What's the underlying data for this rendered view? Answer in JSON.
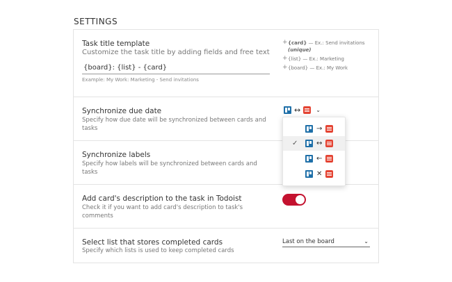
{
  "section_heading": "SETTINGS",
  "task_title": {
    "title": "Task title template",
    "description": "Customize the task title by adding fields and free text",
    "value": "{board}: {list} - {card}",
    "example": "Example: My Work: Marketing - Send invitations",
    "hints": [
      {
        "field": "{card}",
        "text": " — Ex.: Send invitations ",
        "note": "(unique)"
      },
      {
        "field": "{list}",
        "text": " — Ex.: Marketing",
        "note": ""
      },
      {
        "field": "{board}",
        "text": " — Ex.: My Work",
        "note": ""
      }
    ]
  },
  "due_date": {
    "title": "Synchronize due date",
    "description": "Specify how due date will be synchronized between cards and tasks",
    "selected_direction": "↔"
  },
  "labels": {
    "title": "Synchronize labels",
    "description": "Specify how labels will be synchronized between cards and tasks"
  },
  "description_opt": {
    "title": "Add card's description to the task in Todoist",
    "description": "Check it if you want to add card's description to task's comments",
    "enabled": true
  },
  "completed_list": {
    "title": "Select list that stores completed cards",
    "description": "Specify which lists is used to keep completed cards",
    "selected": "Last on the board"
  },
  "sync_menu": {
    "options": [
      {
        "arrow": "→",
        "checked": false
      },
      {
        "arrow": "↔",
        "checked": true
      },
      {
        "arrow": "←",
        "checked": false
      },
      {
        "arrow": "✕",
        "checked": false
      }
    ],
    "check_mark": "✓"
  },
  "colors": {
    "trello": "#1e6fa8",
    "todoist": "#e44332",
    "toggle_on": "#c4122f"
  }
}
